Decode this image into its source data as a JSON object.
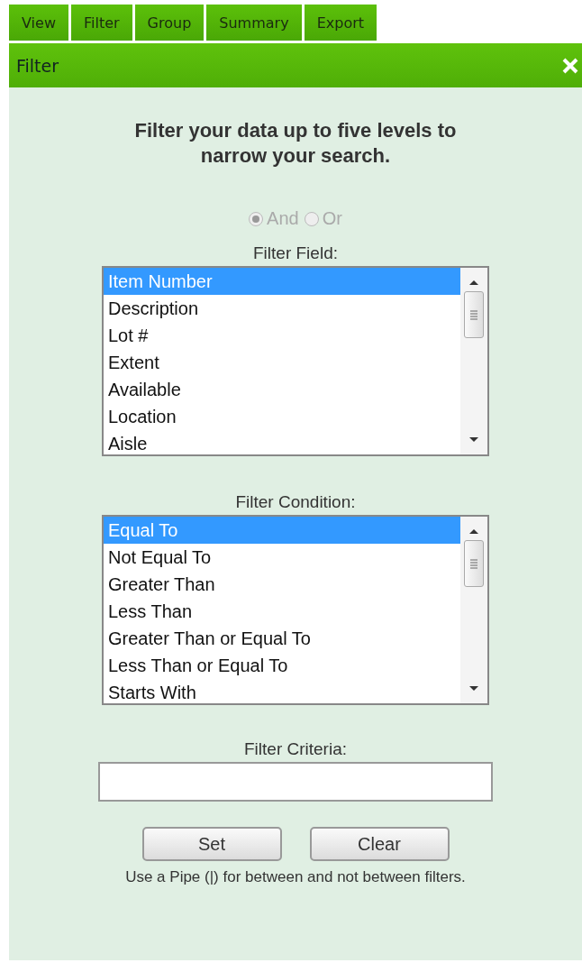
{
  "tabs": [
    {
      "label": "View",
      "selected": false
    },
    {
      "label": "Filter",
      "selected": false
    },
    {
      "label": "Group",
      "selected": false
    },
    {
      "label": "Summary",
      "selected": false
    },
    {
      "label": "Export",
      "selected": false
    }
  ],
  "panel": {
    "title": "Filter",
    "heading": "Filter your data up to five levels to narrow your search.",
    "logic": [
      {
        "label": "And",
        "selected": true,
        "disabled": true
      },
      {
        "label": "Or",
        "selected": false,
        "disabled": true
      }
    ],
    "field_list": {
      "label": "Filter Field:",
      "items": [
        {
          "label": "Item Number",
          "selected": true
        },
        {
          "label": "Description",
          "selected": false
        },
        {
          "label": "Lot #",
          "selected": false
        },
        {
          "label": "Extent",
          "selected": false
        },
        {
          "label": "Available",
          "selected": false
        },
        {
          "label": "Location",
          "selected": false
        },
        {
          "label": "Aisle",
          "selected": false
        }
      ]
    },
    "condition_list": {
      "label": "Filter Condition:",
      "items": [
        {
          "label": "Equal To",
          "selected": true
        },
        {
          "label": "Not Equal To",
          "selected": false
        },
        {
          "label": "Greater Than",
          "selected": false
        },
        {
          "label": "Less Than",
          "selected": false
        },
        {
          "label": "Greater Than or Equal To",
          "selected": false
        },
        {
          "label": "Less Than or Equal To",
          "selected": false
        },
        {
          "label": "Starts With",
          "selected": false
        }
      ]
    },
    "criteria": {
      "label": "Filter Criteria:"
    },
    "buttons": [
      "Set",
      "Clear"
    ],
    "note": "Use a Pipe (|) for between and not between filters."
  }
}
